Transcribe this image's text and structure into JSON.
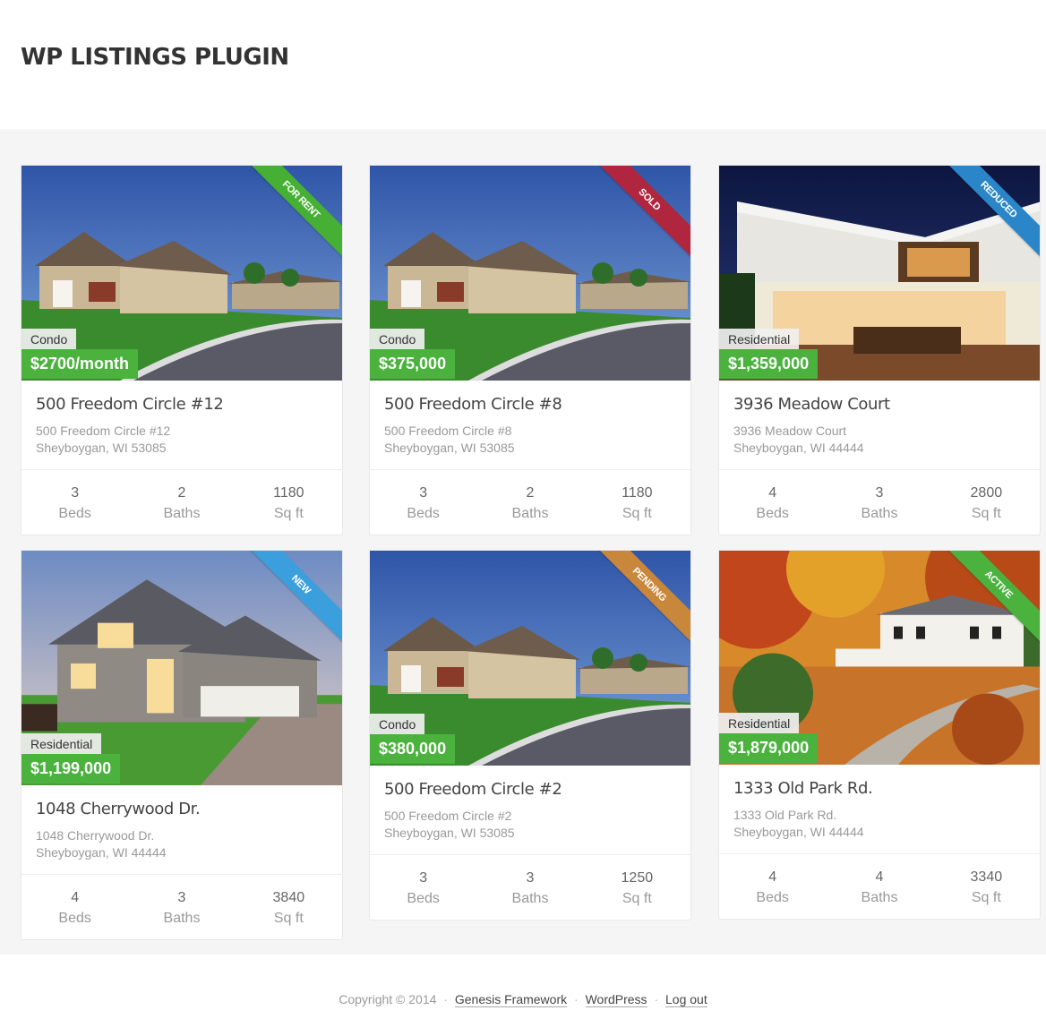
{
  "site": {
    "title": "WP LISTINGS PLUGIN"
  },
  "listings": [
    {
      "status": "FOR RENT",
      "status_color": "#46b034",
      "type": "Condo",
      "price": "$2700/month",
      "title": "500 Freedom Circle #12",
      "address1": "500 Freedom Circle #12",
      "address2": "Sheyboygan, WI 53085",
      "beds": "3",
      "baths": "2",
      "sqft": "1180",
      "image": "suburban-street-photo"
    },
    {
      "status": "SOLD",
      "status_color": "#b0263f",
      "type": "Condo",
      "price": "$375,000",
      "title": "500 Freedom Circle #8",
      "address1": "500 Freedom Circle #8",
      "address2": "Sheyboygan, WI 53085",
      "beds": "3",
      "baths": "2",
      "sqft": "1180",
      "image": "suburban-street-photo"
    },
    {
      "status": "REDUCED",
      "status_color": "#2a86c8",
      "type": "Residential",
      "price": "$1,359,000",
      "title": "3936 Meadow Court",
      "address1": "3936 Meadow Court",
      "address2": "Sheyboygan, WI 44444",
      "beds": "4",
      "baths": "3",
      "sqft": "2800",
      "image": "modern-house-night-photo"
    },
    {
      "status": "NEW",
      "status_color": "#3a9fdc",
      "type": "Residential",
      "price": "$1,199,000",
      "title": "1048 Cherrywood Dr.",
      "address1": "1048 Cherrywood Dr.",
      "address2": "Sheyboygan, WI 44444",
      "beds": "4",
      "baths": "3",
      "sqft": "3840",
      "image": "two-story-house-dusk-photo"
    },
    {
      "status": "PENDING",
      "status_color": "#c8873a",
      "type": "Condo",
      "price": "$380,000",
      "title": "500 Freedom Circle #2",
      "address1": "500 Freedom Circle #2",
      "address2": "Sheyboygan, WI 53085",
      "beds": "3",
      "baths": "3",
      "sqft": "1250",
      "image": "suburban-street-photo"
    },
    {
      "status": "ACTIVE",
      "status_color": "#4ab23d",
      "type": "Residential",
      "price": "$1,879,000",
      "title": "1333 Old Park Rd.",
      "address1": "1333 Old Park Rd.",
      "address2": "Sheyboygan, WI 44444",
      "beds": "4",
      "baths": "4",
      "sqft": "3340",
      "image": "white-house-autumn-photo"
    }
  ],
  "labels": {
    "beds": "Beds",
    "baths": "Baths",
    "sqft": "Sq ft"
  },
  "footer": {
    "copyright": "Copyright © 2014",
    "sep": "·",
    "links": [
      "Genesis Framework",
      "WordPress",
      "Log out"
    ]
  }
}
